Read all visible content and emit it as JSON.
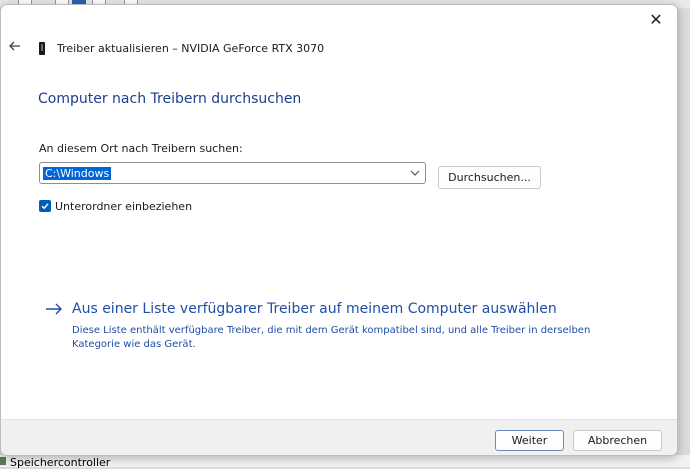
{
  "background": {
    "taskbar_item": "Speichercontroller"
  },
  "dialog": {
    "title": "Treiber aktualisieren – NVIDIA GeForce RTX 3070",
    "heading": "Computer nach Treibern durchsuchen",
    "path_label": "An diesem Ort nach Treibern suchen:",
    "path_value": "C:\\Windows",
    "browse_label": "Durchsuchen...",
    "include_subfolders_label": "Unterordner einbeziehen",
    "include_subfolders_checked": true,
    "pick_title": "Aus einer Liste verfügbarer Treiber auf meinem Computer auswählen",
    "pick_description": "Diese Liste enthält verfügbare Treiber, die mit dem Gerät kompatibel sind, und alle Treiber in derselben Kategorie wie das Gerät.",
    "next_label": "Weiter",
    "cancel_label": "Abbrechen"
  },
  "icons": {
    "close": "close-icon",
    "back": "back-arrow-icon",
    "device": "device-icon",
    "dropdown": "chevron-down-icon",
    "checkbox": "checkmark-icon",
    "link_arrow": "arrow-right-icon"
  },
  "colors": {
    "accent": "#005fb8",
    "heading": "#1e3e8c",
    "link": "#1f4fa6"
  }
}
